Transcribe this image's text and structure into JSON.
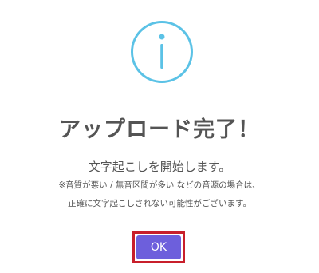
{
  "dialog": {
    "icon": "info-icon",
    "title": "アップロード完了！",
    "subtitle": "文字起こしを開始します。",
    "note_line1": "※音質が悪い / 無音区間が多い などの音源の場合は、",
    "note_line2": "正確に文字起こしされない可能性がございます。",
    "ok_label": "OK"
  },
  "colors": {
    "icon": "#5bc2e6",
    "text": "#545454",
    "button": "#6d5fdc",
    "highlight": "#c81f2b"
  }
}
